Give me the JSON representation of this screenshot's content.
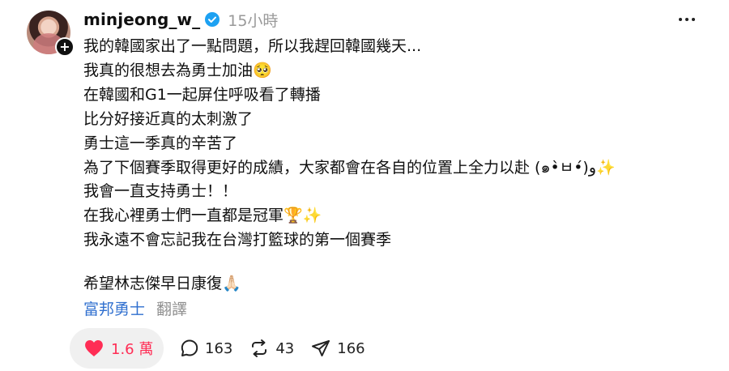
{
  "post": {
    "username": "minjeong_w_",
    "time": "15小時",
    "lines": [
      "我的韓國家出了一點問題，所以我趕回韓國幾天...",
      "我真的很想去為勇士加油🥺",
      "在韓國和G1一起屏住呼吸看了轉播",
      "比分好接近真的太刺激了",
      "勇士這一季真的辛苦了",
      "為了下個賽季取得更好的成績，大家都會在各自的位置上全力以赴 (๑•̀ㅂ•́)و✨",
      "我會一直支持勇士！！",
      "在我心裡勇士們一直都是冠軍🏆✨",
      "我永遠不會忘記我在台灣打籃球的第一個賽季",
      "希望林志傑早日康復🙏🏻"
    ],
    "tag": "富邦勇士",
    "translate": "翻譯"
  },
  "actions": {
    "likes": "1.6 萬",
    "comments": "163",
    "reposts": "43",
    "shares": "166"
  },
  "colors": {
    "like": "#ff2d55",
    "tag": "#2f6fcf",
    "verified": "#1da1f2"
  }
}
